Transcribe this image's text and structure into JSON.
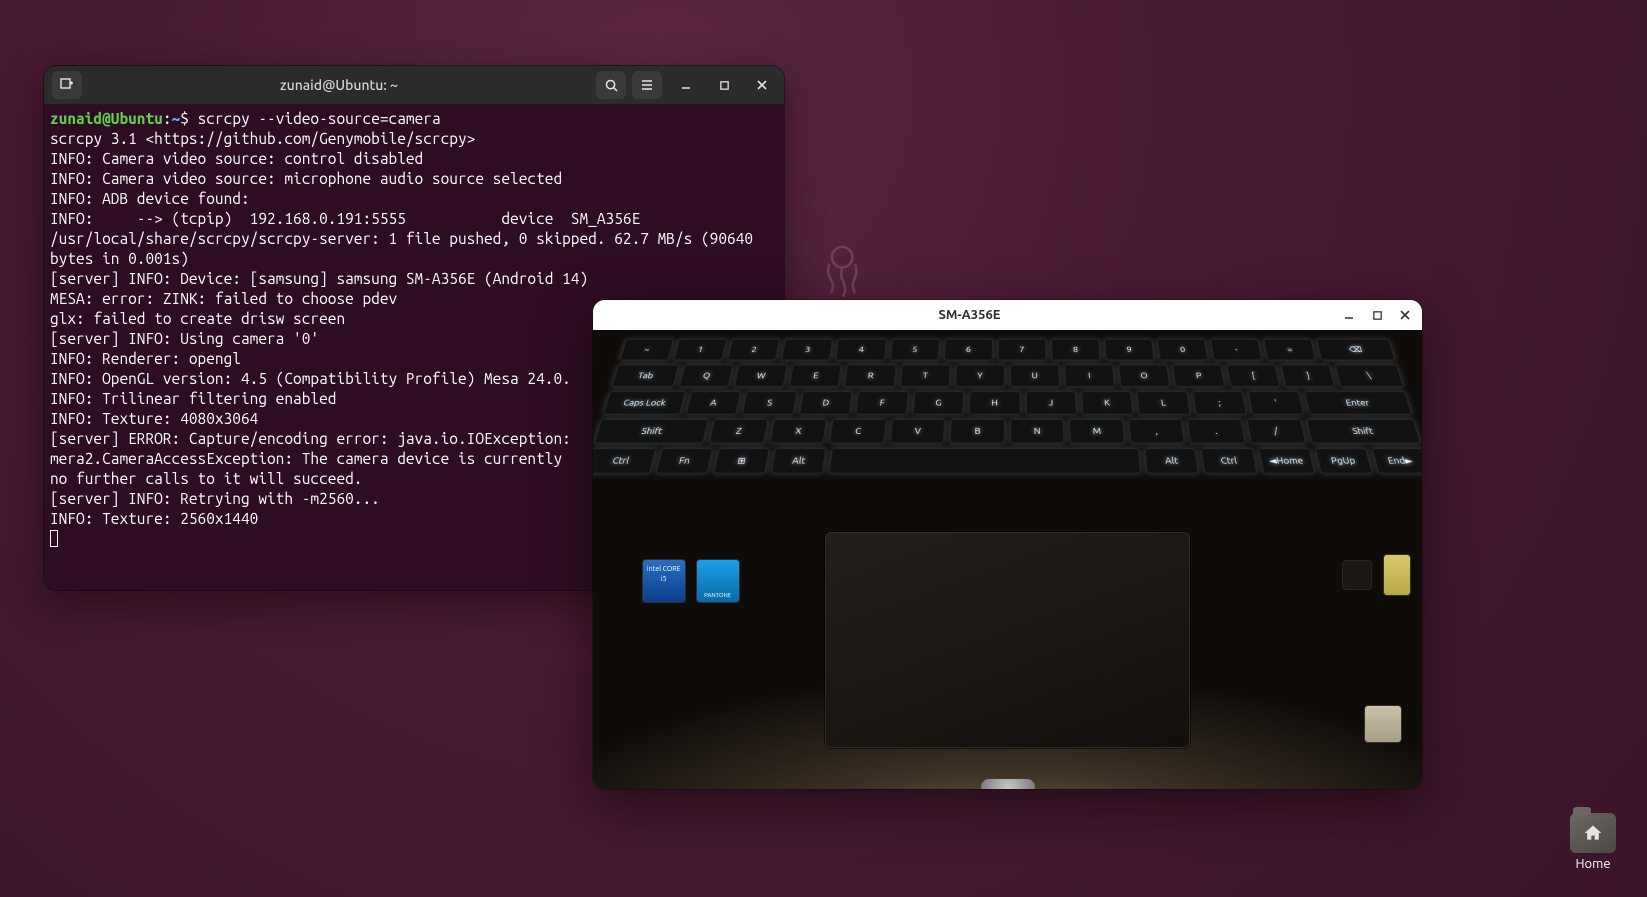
{
  "terminal": {
    "title": "zunaid@Ubuntu: ~",
    "prompt_user": "zunaid@Ubuntu",
    "prompt_sep": ":",
    "prompt_path": "~",
    "prompt_dollar": "$",
    "command": "scrcpy --video-source=camera",
    "lines": [
      "scrcpy 3.1 <https://github.com/Genymobile/scrcpy>",
      "INFO: Camera video source: control disabled",
      "INFO: Camera video source: microphone audio source selected",
      "INFO: ADB device found:",
      "INFO:     --> (tcpip)  192.168.0.191:5555           device  SM_A356E",
      "/usr/local/share/scrcpy/scrcpy-server: 1 file pushed, 0 skipped. 62.7 MB/s (90640 bytes in 0.001s)",
      "[server] INFO: Device: [samsung] samsung SM-A356E (Android 14)",
      "MESA: error: ZINK: failed to choose pdev",
      "glx: failed to create drisw screen",
      "[server] INFO: Using camera '0'",
      "INFO: Renderer: opengl",
      "INFO: OpenGL version: 4.5 (Compatibility Profile) Mesa 24.0.",
      "INFO: Trilinear filtering enabled",
      "INFO: Texture: 4080x3064",
      "[server] ERROR: Capture/encoding error: java.io.IOException:",
      "mera2.CameraAccessException: The camera device is currently ",
      "no further calls to it will succeed.",
      "[server] INFO: Retrying with -m2560...",
      "INFO: Texture: 2560x1440"
    ]
  },
  "camera_window": {
    "title": "SM-A356E"
  },
  "desktop": {
    "home_label": "Home"
  }
}
